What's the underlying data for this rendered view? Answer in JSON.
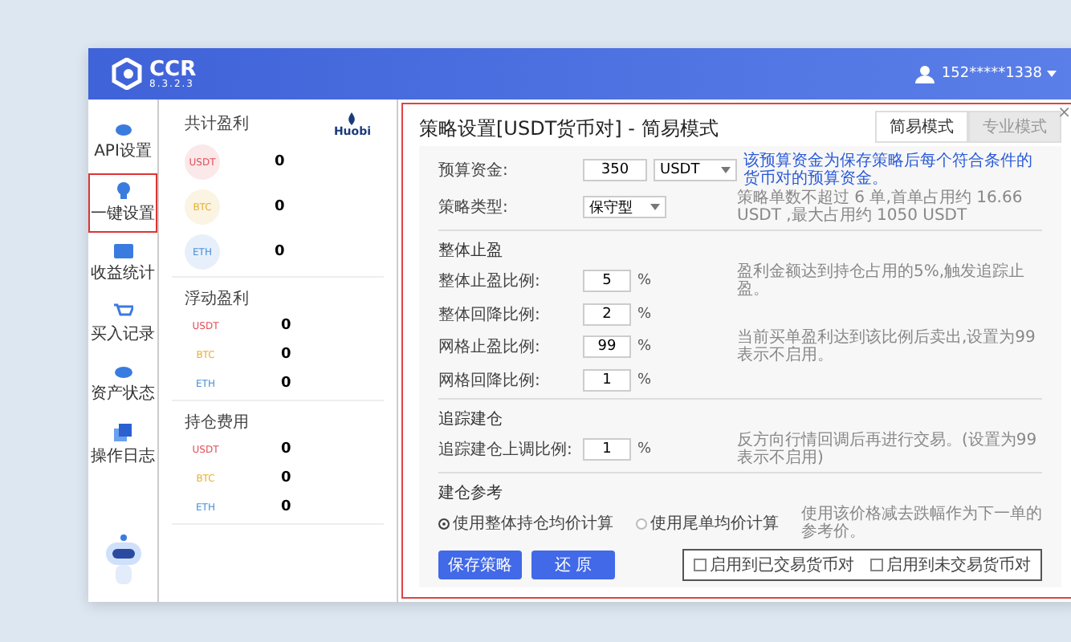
{
  "header": {
    "logo": "CCR",
    "version": "8.3.2.3",
    "user": "152*****1338"
  },
  "sidebar": {
    "items": [
      {
        "label": "API设置",
        "selected": false
      },
      {
        "label": "一键设置",
        "selected": true
      },
      {
        "label": "收益统计",
        "selected": false
      },
      {
        "label": "买入记录",
        "selected": false
      },
      {
        "label": "资产状态",
        "selected": false
      },
      {
        "label": "操作日志",
        "selected": false
      }
    ]
  },
  "left_panel": {
    "exchange": "Huobi",
    "cards": [
      {
        "title": "共计盈利",
        "kind": "badge",
        "rows": [
          {
            "coin": "USDT",
            "value": "0",
            "color": "#e0505a"
          },
          {
            "coin": "BTC",
            "value": "0",
            "color": "#e8b030"
          },
          {
            "coin": "ETH",
            "value": "0",
            "color": "#4a90d9"
          }
        ]
      },
      {
        "title": "浮动盈利",
        "kind": "plain",
        "rows": [
          {
            "coin": "USDT",
            "value": "0",
            "color": "#e0505a"
          },
          {
            "coin": "BTC",
            "value": "0",
            "color": "#e8b030"
          },
          {
            "coin": "ETH",
            "value": "0",
            "color": "#4a90d9"
          }
        ]
      },
      {
        "title": "持仓费用",
        "kind": "plain",
        "rows": [
          {
            "coin": "USDT",
            "value": "0",
            "color": "#e0505a"
          },
          {
            "coin": "BTC",
            "value": "0",
            "color": "#e8b030"
          },
          {
            "coin": "ETH",
            "value": "0",
            "color": "#4a90d9"
          }
        ]
      }
    ]
  },
  "dialog": {
    "title": "策略设置[USDT货币对] - 简易模式",
    "close": "×",
    "tabs": [
      {
        "label": "简易模式",
        "selected": true
      },
      {
        "label": "专业模式",
        "selected": false
      }
    ],
    "budget": {
      "label": "预算资金:",
      "value": "350",
      "select": "USDT",
      "note": "该预算资金为保存策略后每个符合条件的货币对的预算资金。"
    },
    "strategy": {
      "label": "策略类型:",
      "select": "保守型",
      "note": "策略单数不超过 6 单,首单占用约 16.66 USDT ,最大占用约 1050 USDT"
    },
    "sections": [
      {
        "heading": "整体止盈",
        "rows": [
          {
            "label": "整体止盈比例:",
            "value": "5",
            "unit": "%",
            "note": "盈利金额达到持仓占用的5%,触发追踪止盈。"
          },
          {
            "label": "整体回降比例:",
            "value": "2",
            "unit": "%"
          },
          {
            "label": "网格止盈比例:",
            "value": "99",
            "unit": "%",
            "note": "当前买单盈利达到该比例后卖出,设置为99表示不启用。"
          },
          {
            "label": "网格回降比例:",
            "value": "1",
            "unit": "%"
          }
        ]
      },
      {
        "heading": "追踪建仓",
        "rows": [
          {
            "label": "追踪建仓上调比例:",
            "value": "1",
            "unit": "%",
            "note": "反方向行情回调后再进行交易。(设置为99表示不启用)"
          }
        ]
      },
      {
        "heading": "建仓参考",
        "radios": [
          {
            "label": "使用整体持仓均价计算",
            "selected": true
          },
          {
            "label": "使用尾单均价计算",
            "selected": false
          }
        ],
        "note": "使用该价格减去跌幅作为下一单的参考价。"
      }
    ],
    "buttons": [
      "保存策略",
      "还 原"
    ],
    "checks": [
      {
        "label": "启用到已交易货币对",
        "checked": false
      },
      {
        "label": "启用到未交易货币对",
        "checked": false
      }
    ]
  }
}
